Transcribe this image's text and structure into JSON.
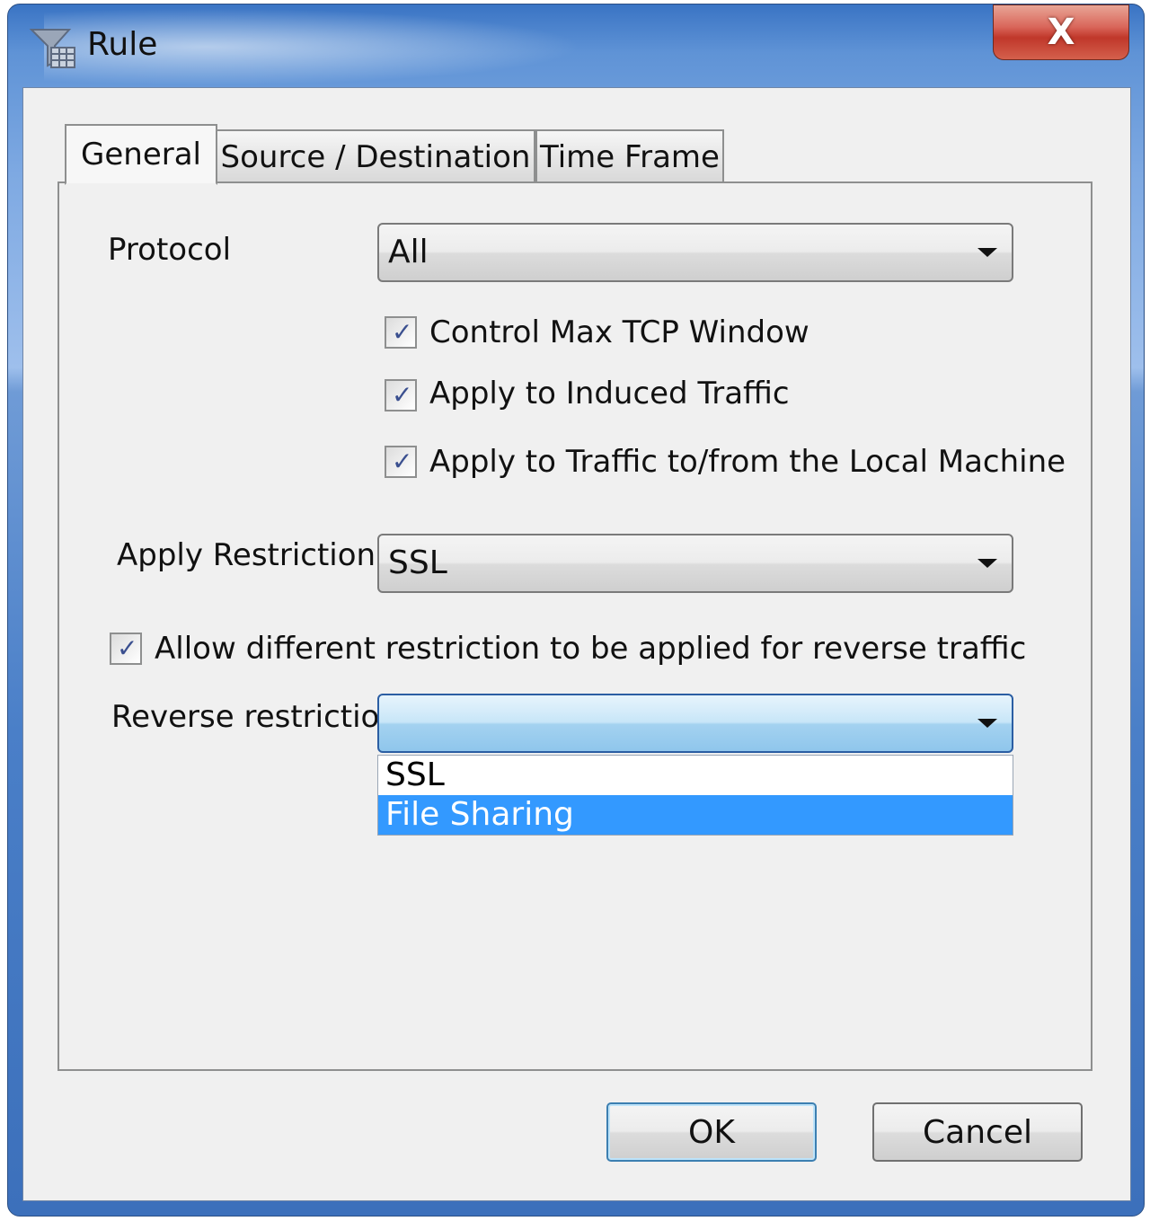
{
  "window": {
    "title": "Rule",
    "close_glyph": "X"
  },
  "tabs": [
    {
      "label": "General",
      "active": true
    },
    {
      "label": "Source / Destination",
      "active": false
    },
    {
      "label": "Time Frame",
      "active": false
    }
  ],
  "general": {
    "protocol_label": "Protocol",
    "protocol_value": "All",
    "checkboxes": [
      {
        "label": "Control Max TCP Window",
        "checked": true
      },
      {
        "label": "Apply to Induced Traffic",
        "checked": true
      },
      {
        "label": "Apply to Traffic to/from the Local Machine",
        "checked": true
      }
    ],
    "restriction_label": "Apply Restriction:",
    "restriction_value": "SSL",
    "allow_reverse": {
      "label": "Allow different restriction to be applied for reverse traffic",
      "checked": true
    },
    "reverse_label": "Reverse restriction:",
    "reverse_value": "",
    "reverse_options": [
      {
        "label": "SSL",
        "selected": false
      },
      {
        "label": "File Sharing",
        "selected": true
      }
    ]
  },
  "buttons": {
    "ok": "OK",
    "cancel": "Cancel"
  },
  "colors": {
    "selection": "#3399ff",
    "title_bar": "#5f93d6",
    "close": "#c0372a"
  },
  "icons": {
    "title": "funnel-filter-icon",
    "check": "checkmark-icon",
    "dropdown": "chevron-down-icon"
  }
}
